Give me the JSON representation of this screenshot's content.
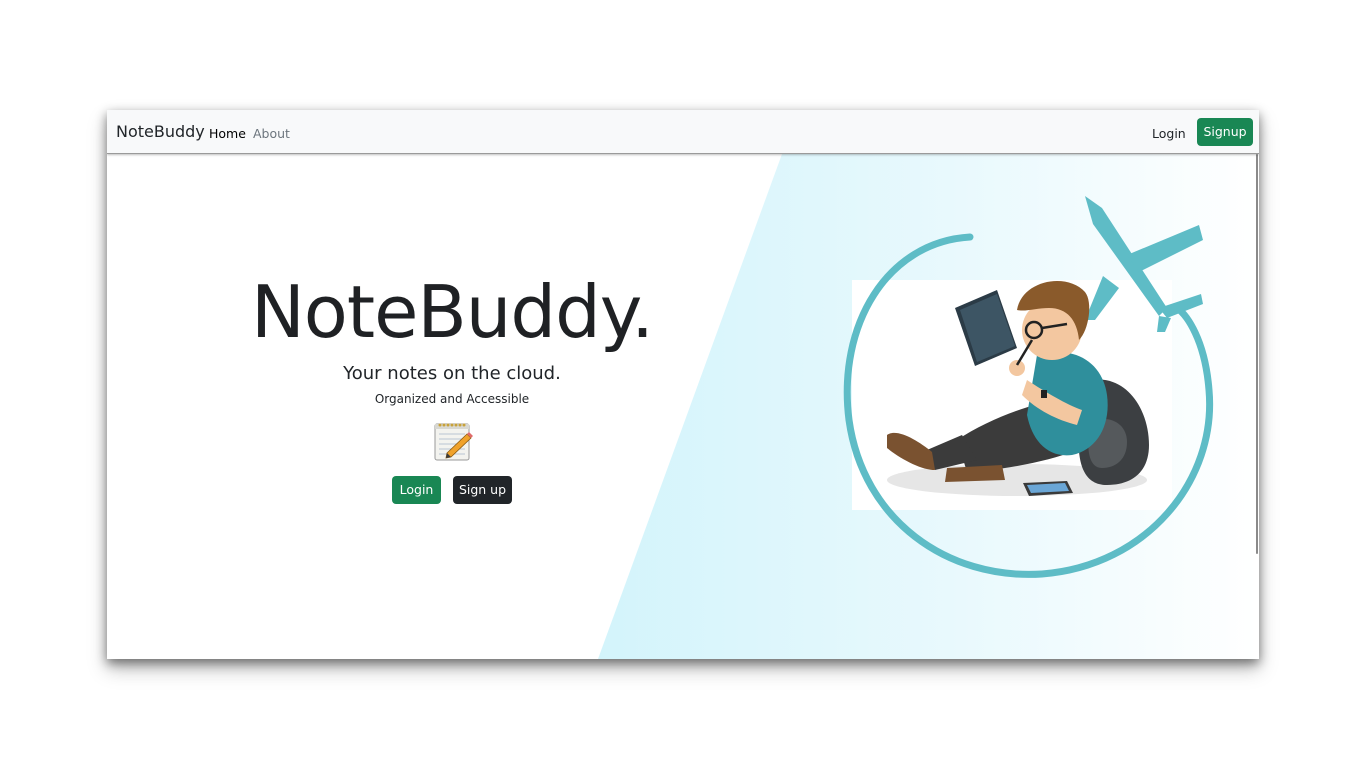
{
  "navbar": {
    "brand": "NoteBuddy",
    "links": [
      {
        "label": "Home"
      },
      {
        "label": "About"
      }
    ],
    "login_label": "Login",
    "signup_label": "Signup"
  },
  "hero": {
    "title": "NoteBuddy.",
    "subtitle": "Your notes on the cloud.",
    "tagline": "Organized and Accessible",
    "login_button": "Login",
    "signup_button": "Sign up"
  },
  "icons": {
    "hero_icon": "notepad-icon",
    "illustration": "student-reading-illustration"
  },
  "colors": {
    "primary_green": "#198754",
    "dark_button": "#212529",
    "accent_teal": "#5ebcc6",
    "accent_light_blue": "#d6f3fb",
    "navbar_bg": "#f8f9fa"
  }
}
